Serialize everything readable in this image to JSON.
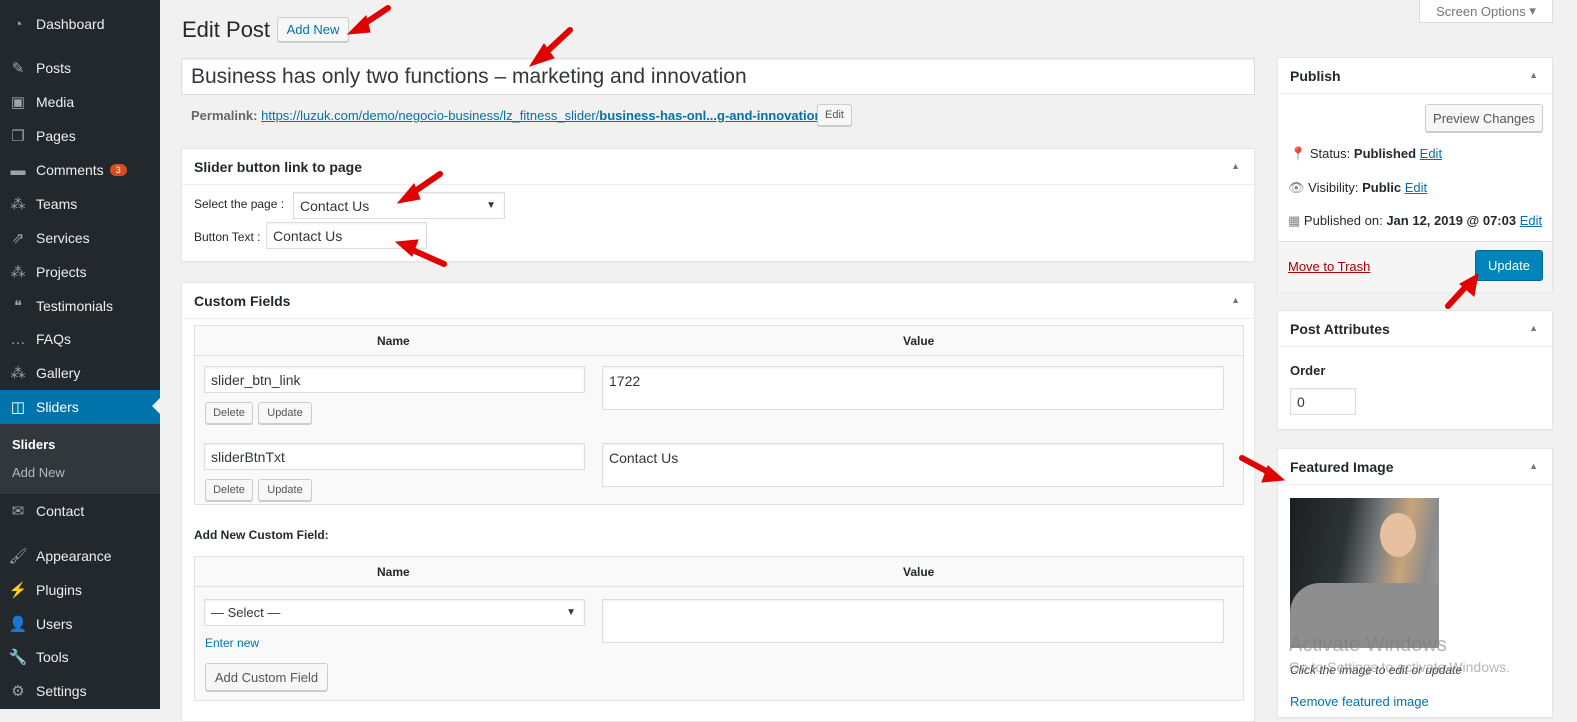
{
  "sidebar": {
    "items": [
      {
        "label": "Dashboard",
        "icon": "dashboard-icon"
      },
      {
        "label": "Posts",
        "icon": "pin-icon"
      },
      {
        "label": "Media",
        "icon": "media-icon"
      },
      {
        "label": "Pages",
        "icon": "pages-icon"
      },
      {
        "label": "Comments",
        "icon": "comment-icon",
        "badge": "3"
      },
      {
        "label": "Teams",
        "icon": "groups-icon"
      },
      {
        "label": "Services",
        "icon": "share-icon"
      },
      {
        "label": "Projects",
        "icon": "groups-icon"
      },
      {
        "label": "Testimonials",
        "icon": "testimonial-icon"
      },
      {
        "label": "FAQs",
        "icon": "format-chat-icon"
      },
      {
        "label": "Gallery",
        "icon": "groups-icon"
      },
      {
        "label": "Sliders",
        "icon": "slides-icon",
        "current": true
      },
      {
        "label": "Contact",
        "icon": "email-icon"
      },
      {
        "label": "Appearance",
        "icon": "brush-icon"
      },
      {
        "label": "Plugins",
        "icon": "plugin-icon"
      },
      {
        "label": "Users",
        "icon": "users-icon"
      },
      {
        "label": "Tools",
        "icon": "wrench-icon"
      },
      {
        "label": "Settings",
        "icon": "settings-icon"
      }
    ],
    "submenu": [
      "Sliders",
      "Add New"
    ]
  },
  "header": {
    "title": "Edit Post",
    "add_new": "Add New",
    "screen_options": "Screen Options"
  },
  "post": {
    "title": "Business has only two functions – marketing and innovation",
    "permalink_label": "Permalink:",
    "permalink_base": "https://luzuk.com/demo/negocio-business/lz_fitness_slider/",
    "permalink_slug": "business-has-onl...g-and-innovation",
    "permalink_end": "/",
    "edit": "Edit"
  },
  "slider_box": {
    "title": "Slider button link to page",
    "select_label": "Select the page :",
    "select_value": "Contact Us",
    "button_text_label": "Button Text :",
    "button_text_value": "Contact Us"
  },
  "custom_fields": {
    "title": "Custom Fields",
    "col_name": "Name",
    "col_value": "Value",
    "rows": [
      {
        "name": "slider_btn_link",
        "value": "1722"
      },
      {
        "name": "sliderBtnTxt",
        "value": "Contact Us"
      }
    ],
    "delete": "Delete",
    "update": "Update",
    "add_new_label": "Add New Custom Field:",
    "select_placeholder": "— Select —",
    "enter_new": "Enter new",
    "add_button": "Add Custom Field"
  },
  "publish": {
    "title": "Publish",
    "preview": "Preview Changes",
    "status_label": "Status:",
    "status": "Published",
    "visibility_label": "Visibility:",
    "visibility": "Public",
    "published_label": "Published on:",
    "published": "Jan 12, 2019 @ 07:03",
    "edit": "Edit",
    "trash": "Move to Trash",
    "update": "Update"
  },
  "attributes": {
    "title": "Post Attributes",
    "order_label": "Order",
    "order": "0"
  },
  "featured": {
    "title": "Featured Image",
    "caption": "Click the image to edit or update",
    "remove": "Remove featured image"
  },
  "watermark": {
    "line1": "Activate Windows",
    "line2": "Go to Settings to activate Windows."
  },
  "colors": {
    "sidebar": "#23282d",
    "accent": "#0073aa",
    "arrow": "#e00000",
    "badge": "#d54e21"
  }
}
